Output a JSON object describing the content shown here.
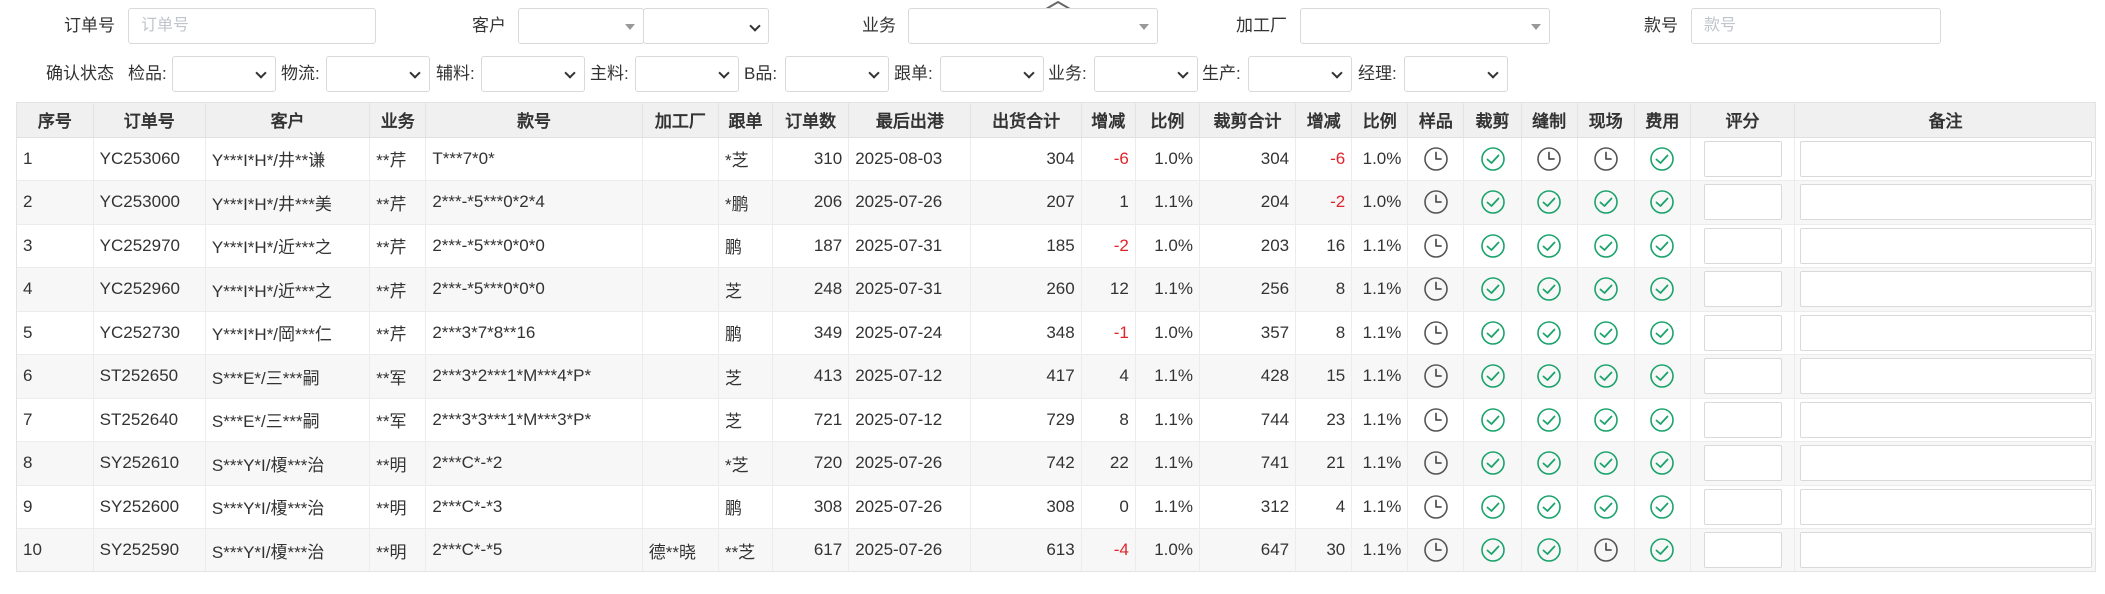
{
  "filters": {
    "order_no": {
      "label": "订单号",
      "placeholder": "订单号"
    },
    "customer": {
      "label": "客户"
    },
    "business": {
      "label": "业务"
    },
    "factory": {
      "label": "加工厂"
    },
    "style_no": {
      "label": "款号",
      "placeholder": "款号"
    }
  },
  "status_filters": {
    "title": "确认状态",
    "items": [
      {
        "label": "检品:"
      },
      {
        "label": "物流:"
      },
      {
        "label": "辅料:"
      },
      {
        "label": "主料:"
      },
      {
        "label": "B品:"
      },
      {
        "label": "跟单:"
      },
      {
        "label": "业务:"
      },
      {
        "label": "生产:"
      },
      {
        "label": "经理:"
      }
    ]
  },
  "table": {
    "headers": [
      "序号",
      "订单号",
      "客户",
      "业务",
      "款号",
      "加工厂",
      "跟单",
      "订单数",
      "最后出港",
      "出货合计",
      "增减",
      "比例",
      "裁剪合计",
      "增减",
      "比例",
      "样品",
      "裁剪",
      "缝制",
      "现场",
      "费用",
      "评分",
      "备注"
    ],
    "rows": [
      {
        "no": "1",
        "order": "YC253060",
        "customer": "Y***I*H*/井**谦",
        "biz": "**芹",
        "style": "T***7*0*",
        "factory": "",
        "follow": "*芝",
        "qty": "310",
        "port": "2025-08-03",
        "ship": "304",
        "ship_diff": "-6",
        "ship_ratio": "1.0%",
        "cut": "304",
        "cut_diff": "-6",
        "cut_ratio": "1.0%",
        "status": [
          "clock",
          "check",
          "clock",
          "clock",
          "check"
        ]
      },
      {
        "no": "2",
        "order": "YC253000",
        "customer": "Y***I*H*/井***美",
        "biz": "**芹",
        "style": "2***-*5***0*2*4",
        "factory": "",
        "follow": "*鹏",
        "qty": "206",
        "port": "2025-07-26",
        "ship": "207",
        "ship_diff": "1",
        "ship_ratio": "1.1%",
        "cut": "204",
        "cut_diff": "-2",
        "cut_ratio": "1.0%",
        "status": [
          "clock",
          "check",
          "check",
          "check",
          "check"
        ]
      },
      {
        "no": "3",
        "order": "YC252970",
        "customer": "Y***I*H*/近***之",
        "biz": "**芹",
        "style": "2***-*5***0*0*0",
        "factory": "",
        "follow": "鹏",
        "qty": "187",
        "port": "2025-07-31",
        "ship": "185",
        "ship_diff": "-2",
        "ship_ratio": "1.0%",
        "cut": "203",
        "cut_diff": "16",
        "cut_ratio": "1.1%",
        "status": [
          "clock",
          "check",
          "check",
          "check",
          "check"
        ]
      },
      {
        "no": "4",
        "order": "YC252960",
        "customer": "Y***I*H*/近***之",
        "biz": "**芹",
        "style": "2***-*5***0*0*0",
        "factory": "",
        "follow": "芝",
        "qty": "248",
        "port": "2025-07-31",
        "ship": "260",
        "ship_diff": "12",
        "ship_ratio": "1.1%",
        "cut": "256",
        "cut_diff": "8",
        "cut_ratio": "1.1%",
        "status": [
          "clock",
          "check",
          "check",
          "check",
          "check"
        ]
      },
      {
        "no": "5",
        "order": "YC252730",
        "customer": "Y***I*H*/岡***仁",
        "biz": "**芹",
        "style": "2***3*7*8**16",
        "factory": "",
        "follow": "鹏",
        "qty": "349",
        "port": "2025-07-24",
        "ship": "348",
        "ship_diff": "-1",
        "ship_ratio": "1.0%",
        "cut": "357",
        "cut_diff": "8",
        "cut_ratio": "1.1%",
        "status": [
          "clock",
          "check",
          "check",
          "check",
          "check"
        ]
      },
      {
        "no": "6",
        "order": "ST252650",
        "customer": "S***E*/三***嗣",
        "biz": "**军",
        "style": "2***3*2***1*M***4*P*",
        "factory": "",
        "follow": "芝",
        "qty": "413",
        "port": "2025-07-12",
        "ship": "417",
        "ship_diff": "4",
        "ship_ratio": "1.1%",
        "cut": "428",
        "cut_diff": "15",
        "cut_ratio": "1.1%",
        "status": [
          "clock",
          "check",
          "check",
          "check",
          "check"
        ]
      },
      {
        "no": "7",
        "order": "ST252640",
        "customer": "S***E*/三***嗣",
        "biz": "**军",
        "style": "2***3*3***1*M***3*P*",
        "factory": "",
        "follow": "芝",
        "qty": "721",
        "port": "2025-07-12",
        "ship": "729",
        "ship_diff": "8",
        "ship_ratio": "1.1%",
        "cut": "744",
        "cut_diff": "23",
        "cut_ratio": "1.1%",
        "status": [
          "clock",
          "check",
          "check",
          "check",
          "check"
        ]
      },
      {
        "no": "8",
        "order": "SY252610",
        "customer": "S***Y*I/榎***治",
        "biz": "**明",
        "style": "2***C*-*2",
        "factory": "",
        "follow": "*芝",
        "qty": "720",
        "port": "2025-07-26",
        "ship": "742",
        "ship_diff": "22",
        "ship_ratio": "1.1%",
        "cut": "741",
        "cut_diff": "21",
        "cut_ratio": "1.1%",
        "status": [
          "clock",
          "check",
          "check",
          "check",
          "check"
        ]
      },
      {
        "no": "9",
        "order": "SY252600",
        "customer": "S***Y*I/榎***治",
        "biz": "**明",
        "style": "2***C*-*3",
        "factory": "",
        "follow": "鹏",
        "qty": "308",
        "port": "2025-07-26",
        "ship": "308",
        "ship_diff": "0",
        "ship_ratio": "1.1%",
        "cut": "312",
        "cut_diff": "4",
        "cut_ratio": "1.1%",
        "status": [
          "clock",
          "check",
          "check",
          "check",
          "check"
        ]
      },
      {
        "no": "10",
        "order": "SY252590",
        "customer": "S***Y*I/榎***治",
        "biz": "**明",
        "style": "2***C*-*5",
        "factory": "德**晓",
        "follow": "**芝",
        "qty": "617",
        "port": "2025-07-26",
        "ship": "613",
        "ship_diff": "-4",
        "ship_ratio": "1.0%",
        "cut": "647",
        "cut_diff": "30",
        "cut_ratio": "1.1%",
        "status": [
          "clock",
          "check",
          "check",
          "clock",
          "check"
        ]
      }
    ]
  },
  "colors": {
    "negative": "#e0242a",
    "check": "#1aa36b",
    "clock": "#555555",
    "header_bg": "#f0f0f0",
    "stripe": "#f7f7f7"
  },
  "icons": {
    "collapse": "chevron-up-icon",
    "clock": "clock-icon",
    "check": "check-circle-icon"
  }
}
